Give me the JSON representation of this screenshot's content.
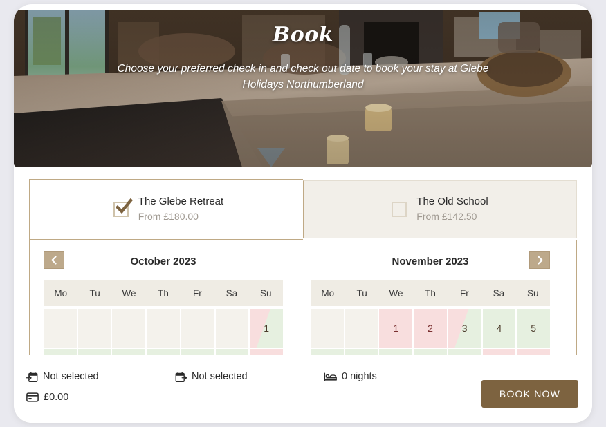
{
  "hero": {
    "title": "Book",
    "subtitle": "Choose your preferred check in and check out date to book your stay at Glebe Holidays Northumberland"
  },
  "properties": [
    {
      "name": "The Glebe Retreat",
      "price": "From £180.00",
      "selected": true,
      "checkbox_icon": "checkbox-checked-icon"
    },
    {
      "name": "The Old School",
      "price": "From £142.50",
      "selected": false,
      "checkbox_icon": "checkbox-unchecked-icon"
    }
  ],
  "calendar": {
    "prev_icon": "chevron-left-icon",
    "next_icon": "chevron-right-icon",
    "weekdays": [
      "Mo",
      "Tu",
      "We",
      "Th",
      "Fr",
      "Sa",
      "Su"
    ],
    "months": [
      {
        "title": "October 2023",
        "cells": [
          {
            "label": "",
            "state": "empty"
          },
          {
            "label": "",
            "state": "empty"
          },
          {
            "label": "",
            "state": "empty"
          },
          {
            "label": "",
            "state": "empty"
          },
          {
            "label": "",
            "state": "empty"
          },
          {
            "label": "",
            "state": "empty"
          },
          {
            "label": "1",
            "state": "split"
          },
          {
            "label": "",
            "state": "free"
          },
          {
            "label": "",
            "state": "free"
          },
          {
            "label": "",
            "state": "free"
          },
          {
            "label": "",
            "state": "free"
          },
          {
            "label": "",
            "state": "free"
          },
          {
            "label": "",
            "state": "free"
          },
          {
            "label": "",
            "state": "booked"
          }
        ]
      },
      {
        "title": "November 2023",
        "cells": [
          {
            "label": "",
            "state": "empty"
          },
          {
            "label": "",
            "state": "empty"
          },
          {
            "label": "1",
            "state": "booked"
          },
          {
            "label": "2",
            "state": "booked"
          },
          {
            "label": "3",
            "state": "split"
          },
          {
            "label": "4",
            "state": "free"
          },
          {
            "label": "5",
            "state": "free"
          },
          {
            "label": "",
            "state": "free"
          },
          {
            "label": "",
            "state": "free"
          },
          {
            "label": "",
            "state": "free"
          },
          {
            "label": "",
            "state": "free"
          },
          {
            "label": "",
            "state": "free"
          },
          {
            "label": "",
            "state": "booked"
          },
          {
            "label": "",
            "state": "booked"
          }
        ]
      }
    ]
  },
  "summary": {
    "checkin": {
      "icon": "calendar-check-in-icon",
      "value": "Not selected"
    },
    "checkout": {
      "icon": "calendar-check-out-icon",
      "value": "Not selected"
    },
    "nights": {
      "icon": "bed-icon",
      "value": "0 nights"
    },
    "total": {
      "icon": "credit-card-icon",
      "value": "£0.00"
    }
  },
  "book_button": {
    "label": "BOOK NOW"
  },
  "colors": {
    "accent_brown": "#7d6340",
    "tan": "#bda98b",
    "border_tan": "#bfa985",
    "booked_pink": "#f8dede",
    "available_green": "#e6f0e0",
    "header_beige": "#efece4",
    "tab_inactive": "#f2efe9"
  }
}
